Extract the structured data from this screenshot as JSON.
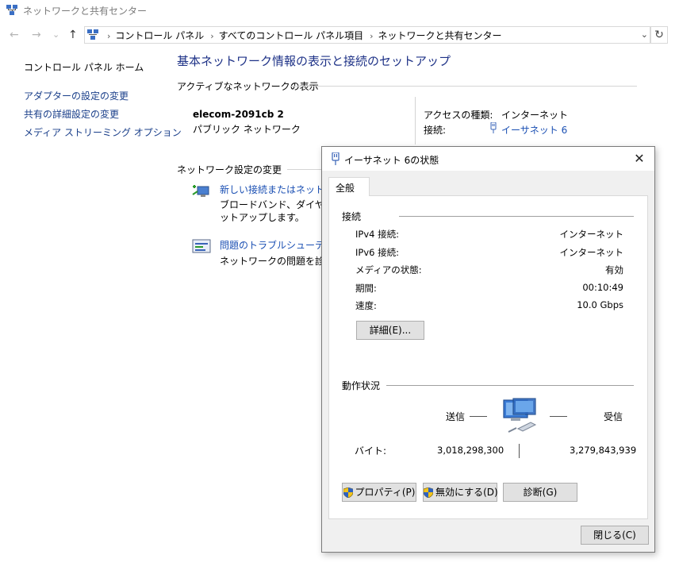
{
  "window": {
    "title": "ネットワークと共有センター",
    "icon": "network-center-icon"
  },
  "nav": {
    "back": "←",
    "forward": "→",
    "recent": "⌄",
    "up": "↑",
    "crumbs": [
      "コントロール パネル",
      "すべてのコントロール パネル項目",
      "ネットワークと共有センター"
    ],
    "dropdown": "⌄",
    "refresh": "↻"
  },
  "sidebar": {
    "home": "コントロール パネル ホーム",
    "items": [
      {
        "label": "アダプターの設定の変更"
      },
      {
        "label": "共有の詳細設定の変更"
      },
      {
        "label": "メディア ストリーミング オプション"
      }
    ]
  },
  "main": {
    "title": "基本ネットワーク情報の表示と接続のセットアップ",
    "active_header": "アクティブなネットワークの表示",
    "network_name": "elecom-2091cb 2",
    "network_category": "パブリック ネットワーク",
    "access_type_label": "アクセスの種類:",
    "access_type_value": "インターネット",
    "connection_label": "接続:",
    "connection_value": "イーサネット 6",
    "change_header": "ネットワーク設定の変更",
    "tasks": [
      {
        "title": "新しい接続またはネットワーク",
        "desc_lines": [
          "ブロードバンド、ダイヤルアップ",
          "ットアップします。"
        ]
      },
      {
        "title": "問題のトラブルシューティング",
        "desc_lines": [
          "ネットワークの問題を診断し"
        ]
      }
    ]
  },
  "dialog": {
    "title": "イーサネット 6の状態",
    "close": "✕",
    "tab": "全般",
    "connection_group": "接続",
    "rows": [
      {
        "label": "IPv4 接続:",
        "value": "インターネット"
      },
      {
        "label": "IPv6 接続:",
        "value": "インターネット"
      },
      {
        "label": "メディアの状態:",
        "value": "有効"
      },
      {
        "label": "期間:",
        "value": "00:10:49"
      },
      {
        "label": "速度:",
        "value": "10.0 Gbps"
      }
    ],
    "details_button": "詳細(E)...",
    "activity_group": "動作状況",
    "sent": "送信",
    "received": "受信",
    "bytes_label": "バイト:",
    "bytes_sent": "3,018,298,300",
    "bytes_received": "3,279,843,939",
    "properties_button": "プロパティ(P)",
    "disable_button": "無効にする(D)",
    "diagnose_button": "診断(G)",
    "close_button": "閉じる(C)"
  },
  "colors": {
    "link": "#1a4fb3",
    "title_blue": "#1e3287",
    "dialog_bg": "#f0f0f0",
    "button_bg": "#e1e1e1"
  }
}
